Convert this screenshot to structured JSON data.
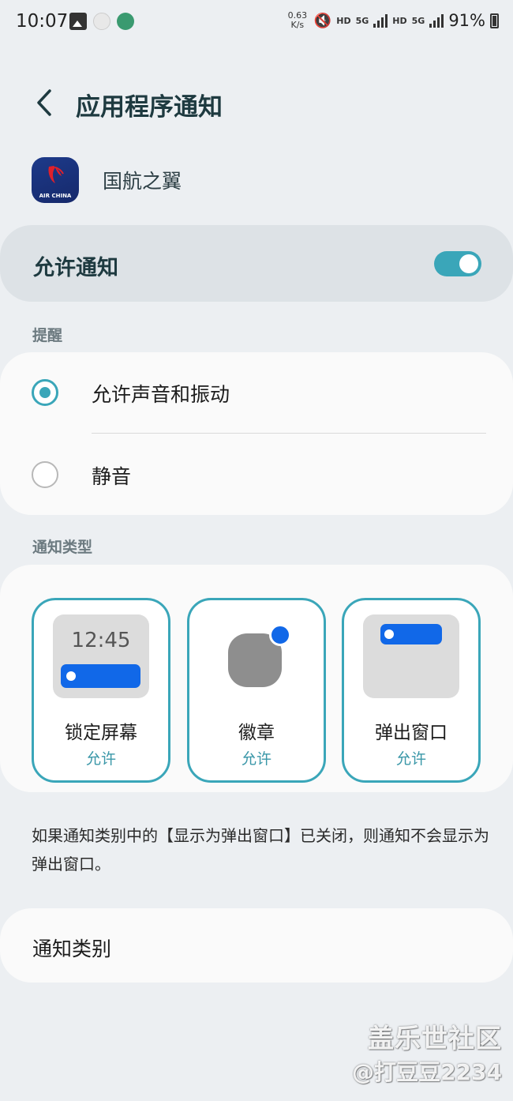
{
  "status_bar": {
    "time": "10:07",
    "net_speed_value": "0.63",
    "net_speed_unit": "K/s",
    "hd1": "HD",
    "g5_1": "5G",
    "hd2": "HD",
    "g5_2": "5G",
    "battery": "91%"
  },
  "header": {
    "title": "应用程序通知"
  },
  "app": {
    "name": "国航之翼",
    "icon_brand": "AIR CHINA"
  },
  "allow": {
    "label": "允许通知",
    "enabled": true
  },
  "alerts": {
    "section_label": "提醒",
    "options": [
      {
        "label": "允许声音和振动",
        "selected": true
      },
      {
        "label": "静音",
        "selected": false
      }
    ]
  },
  "types": {
    "section_label": "通知类型",
    "lock_time": "12:45",
    "tiles": [
      {
        "name": "锁定屏幕",
        "status": "允许"
      },
      {
        "name": "徽章",
        "status": "允许"
      },
      {
        "name": "弹出窗口",
        "status": "允许"
      }
    ]
  },
  "info": {
    "text": "如果通知类别中的【显示为弹出窗口】已关闭，则通知不会显示为弹出窗口。"
  },
  "categories": {
    "label": "通知类别"
  },
  "watermark": {
    "line1": "盖乐世社区",
    "line2": "@打豆豆2234"
  },
  "colors": {
    "accent": "#3aa6b9",
    "notification_blue": "#1168e8",
    "background": "#eceff2"
  }
}
